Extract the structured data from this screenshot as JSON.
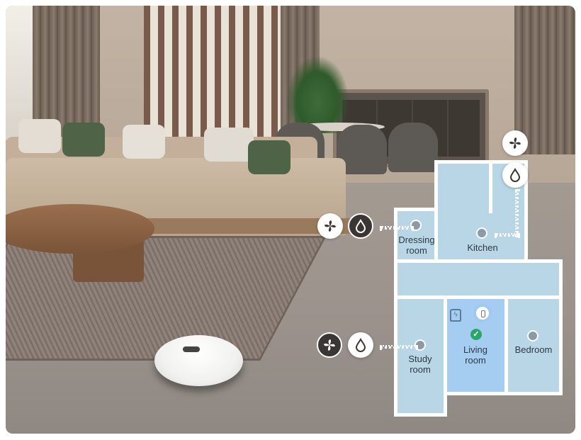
{
  "rooms": [
    {
      "id": "dressing-room",
      "label": "Dressing\nroom"
    },
    {
      "id": "kitchen",
      "label": "Kitchen"
    },
    {
      "id": "study-room",
      "label": "Study\nroom"
    },
    {
      "id": "living-room",
      "label": "Living\nroom",
      "selected": true
    },
    {
      "id": "bedroom",
      "label": "Bedroom"
    }
  ],
  "icons": {
    "fan": "fan-icon",
    "water": "water-drop-icon",
    "check": "check-icon",
    "dock": "charging-dock-icon",
    "robot": "robot-position-icon"
  },
  "colors": {
    "room_fill": "#b8d6e6",
    "room_selected_fill": "#a4cdf1",
    "room_border": "#ffffff",
    "check_green": "#2aa66a",
    "mode_dark": "#3b3533"
  }
}
